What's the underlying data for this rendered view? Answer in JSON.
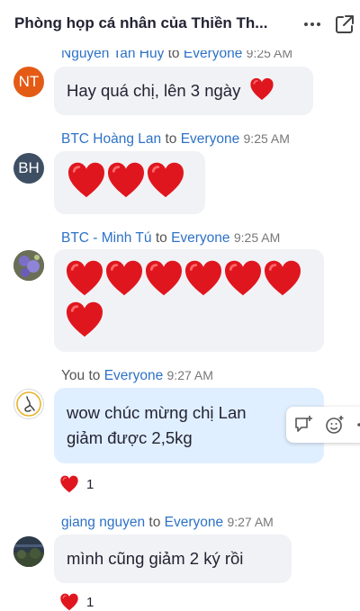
{
  "header": {
    "title": "Phòng họp cá nhân của Thiền Th...",
    "more_icon": "more-options-icon",
    "popout_icon": "pop-out-icon"
  },
  "messages": [
    {
      "avatar_initials": "NT",
      "sender": "Nguyen Tan Huy",
      "to": "to",
      "target": "Everyone",
      "time": "9:25 AM",
      "text": "Hay quá chị, lên 3 ngày",
      "hearts": 1
    },
    {
      "avatar_initials": "BH",
      "sender": "BTC Hoàng Lan",
      "to": "to",
      "target": "Everyone",
      "time": "9:25 AM",
      "hearts": 3
    },
    {
      "avatar_initials": "",
      "sender": "BTC - Minh Tú",
      "to": "to",
      "target": "Everyone",
      "time": "9:25 AM",
      "hearts": 7
    },
    {
      "avatar_initials": "",
      "sender": "You",
      "to": "to",
      "target": "Everyone",
      "time": "9:27 AM",
      "text_line1": "wow chúc mừng chị Lan",
      "text_line2": "giảm được 2,5kg",
      "reaction_count": "1"
    },
    {
      "avatar_initials": "",
      "sender": "giang nguyen",
      "to": "to",
      "target": "Everyone",
      "time": "9:27 AM",
      "text": "mình cũng giảm 2 ký rồi",
      "reaction_count": "1"
    }
  ],
  "colors": {
    "link_blue": "#2d72c6",
    "heart_red": "#e0161e",
    "bubble_gray": "#f1f2f5",
    "bubble_mine": "#e0efff"
  }
}
